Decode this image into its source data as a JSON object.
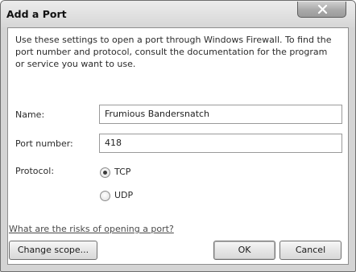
{
  "window": {
    "title": "Add a Port"
  },
  "titlebar": {
    "close_icon": "close-x-icon"
  },
  "description": "Use these settings to open a port through Windows Firewall. To find the port number and protocol, consult the documentation for the program or service you want to use.",
  "form": {
    "name_label": "Name:",
    "name_value": "Frumious Bandersnatch",
    "port_label": "Port number:",
    "port_value": "418",
    "protocol_label": "Protocol:",
    "protocol_options": [
      {
        "label": "TCP",
        "selected": true
      },
      {
        "label": "UDP",
        "selected": false
      }
    ]
  },
  "risk_link": "What are the risks of opening a port?",
  "buttons": {
    "change_scope": "Change scope...",
    "ok": "OK",
    "cancel": "Cancel"
  }
}
